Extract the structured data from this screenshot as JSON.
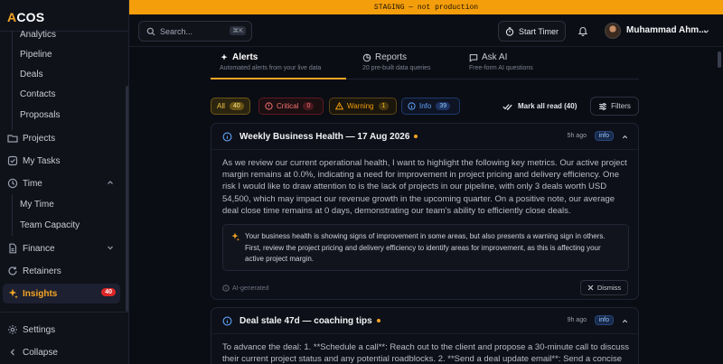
{
  "app": {
    "logo_accent": "A",
    "logo_rest": "COS",
    "accent_color": "#f5a524"
  },
  "banner": {
    "text": "STAGING — not production"
  },
  "topbar": {
    "search_placeholder": "Search...",
    "search_shortcut": "⌘K",
    "timer_label": "Start Timer",
    "user_name": "Muhammad Ahm..."
  },
  "sidebar": {
    "items": [
      {
        "label": "Analytics",
        "icon": "none"
      },
      {
        "label": "Pipeline",
        "icon": "none"
      },
      {
        "label": "Deals",
        "icon": "none"
      },
      {
        "label": "Contacts",
        "icon": "none"
      },
      {
        "label": "Proposals",
        "icon": "none"
      },
      {
        "label": "Projects",
        "icon": "folder-icon"
      },
      {
        "label": "My Tasks",
        "icon": "checkbox-icon"
      },
      {
        "label": "Time",
        "icon": "clock-icon"
      },
      {
        "label": "My Time",
        "icon": "none"
      },
      {
        "label": "Team Capacity",
        "icon": "none"
      },
      {
        "label": "Finance",
        "icon": "file-icon"
      },
      {
        "label": "Retainers",
        "icon": "refresh-icon"
      },
      {
        "label": "Insights",
        "icon": "sparkle-icon",
        "badge": "40"
      },
      {
        "label": "Settings",
        "icon": "gear-icon"
      },
      {
        "label": "Collapse",
        "icon": "chevron-left-icon"
      }
    ]
  },
  "tabs": [
    {
      "label": "Alerts",
      "sub": "Automated alerts from your live data",
      "icon": "sparkle-icon"
    },
    {
      "label": "Reports",
      "sub": "20 pre-built data queries",
      "icon": "chart-icon"
    },
    {
      "label": "Ask AI",
      "sub": "Free-form AI questions",
      "icon": "chat-icon"
    }
  ],
  "filters": {
    "chips": [
      {
        "label": "All",
        "count": "40"
      },
      {
        "label": "Critical",
        "count": "0"
      },
      {
        "label": "Warning",
        "count": "1"
      },
      {
        "label": "Info",
        "count": "39"
      }
    ],
    "mark_all_read": "Mark all read (40)",
    "filters_label": "Filters"
  },
  "cards": [
    {
      "title": "Weekly Business Health — 17 Aug 2026",
      "time": "5h ago",
      "tag": "info",
      "body": "As we review our current operational health, I want to highlight the following key metrics. Our active project margin remains at 0.0%, indicating a need for improvement in project pricing and delivery efficiency. One risk I would like to draw attention to is the lack of projects in our pipeline, with only 3 deals worth USD 54,500, which may impact our revenue growth in the upcoming quarter. On a positive note, our average deal close time remains at 0 days, demonstrating our team's ability to efficiently close deals.",
      "ai_summary": "Your business health is showing signs of improvement in some areas, but also presents a warning sign in others. First, review the project pricing and delivery efficiency to identify areas for improvement, as this is affecting your active project margin.",
      "ai_generated": "AI-generated",
      "dismiss": "Dismiss"
    },
    {
      "title": "Deal stale 47d — coaching tips",
      "time": "9h ago",
      "tag": "info",
      "body": "To advance the deal: 1. **Schedule a call**: Reach out to the client and propose a 30-minute call to discuss their current project status and any potential roadblocks. 2. **Send a deal update email**: Send a concise"
    }
  ]
}
